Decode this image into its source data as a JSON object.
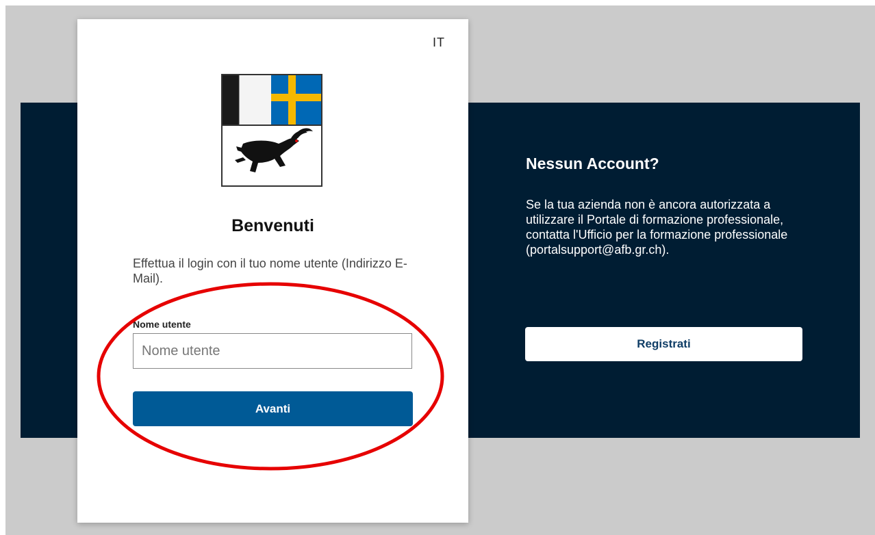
{
  "login": {
    "language": "IT",
    "crest_icon": "graubuenden-coat-of-arms-icon",
    "title": "Benvenuti",
    "instructions": "Effettua il login con il tuo nome utente (Indirizzo E-Mail).",
    "username_label": "Nome utente",
    "username_placeholder": "Nome utente",
    "username_value": "",
    "next_label": "Avanti"
  },
  "signup": {
    "title": "Nessun Account?",
    "text": "Se la tua azienda non è ancora autorizzata a utilizzare il Portale di formazione professionale, contatta l'Ufficio per la formazione professionale (portalsupport@afb.gr.ch).",
    "register_label": "Registrati"
  },
  "colors": {
    "dark_panel": "#001d33",
    "primary_button": "#005a96",
    "annotation": "#e60000"
  }
}
